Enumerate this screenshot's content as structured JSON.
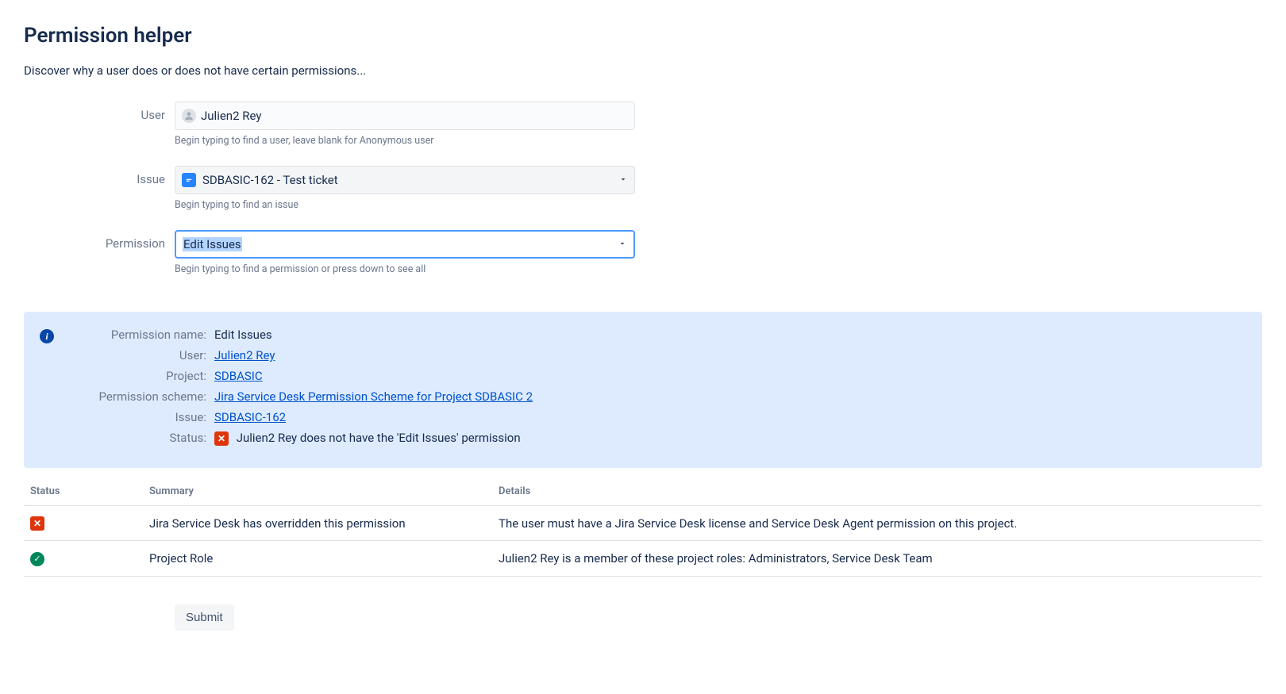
{
  "title": "Permission helper",
  "subtitle": "Discover why a user does or does not have certain permissions...",
  "form": {
    "user": {
      "label": "User",
      "value": "Julien2 Rey",
      "help": "Begin typing to find a user, leave blank for Anonymous user"
    },
    "issue": {
      "label": "Issue",
      "value": "SDBASIC-162 - Test ticket",
      "help": "Begin typing to find an issue"
    },
    "permission": {
      "label": "Permission",
      "value": "Edit Issues",
      "help": "Begin typing to find a permission or press down to see all"
    }
  },
  "info": {
    "rows": [
      {
        "key": "Permission name:",
        "value": "Edit Issues",
        "link": false
      },
      {
        "key": "User:",
        "value": "Julien2 Rey",
        "link": true
      },
      {
        "key": "Project:",
        "value": "SDBASIC",
        "link": true
      },
      {
        "key": "Permission scheme:",
        "value": "Jira Service Desk Permission Scheme for Project SDBASIC 2",
        "link": true
      },
      {
        "key": "Issue:",
        "value": "SDBASIC-162",
        "link": true
      }
    ],
    "status_key": "Status:",
    "status_text": "Julien2 Rey does not have the 'Edit Issues' permission"
  },
  "table": {
    "headers": {
      "status": "Status",
      "summary": "Summary",
      "details": "Details"
    },
    "rows": [
      {
        "status_type": "fail",
        "summary": "Jira Service Desk has overridden this permission",
        "details": "The user must have a Jira Service Desk license and Service Desk Agent permission on this project."
      },
      {
        "status_type": "pass",
        "summary": "Project Role",
        "details": "Julien2 Rey is a member of these project roles: Administrators, Service Desk Team"
      }
    ]
  },
  "submit_label": "Submit"
}
